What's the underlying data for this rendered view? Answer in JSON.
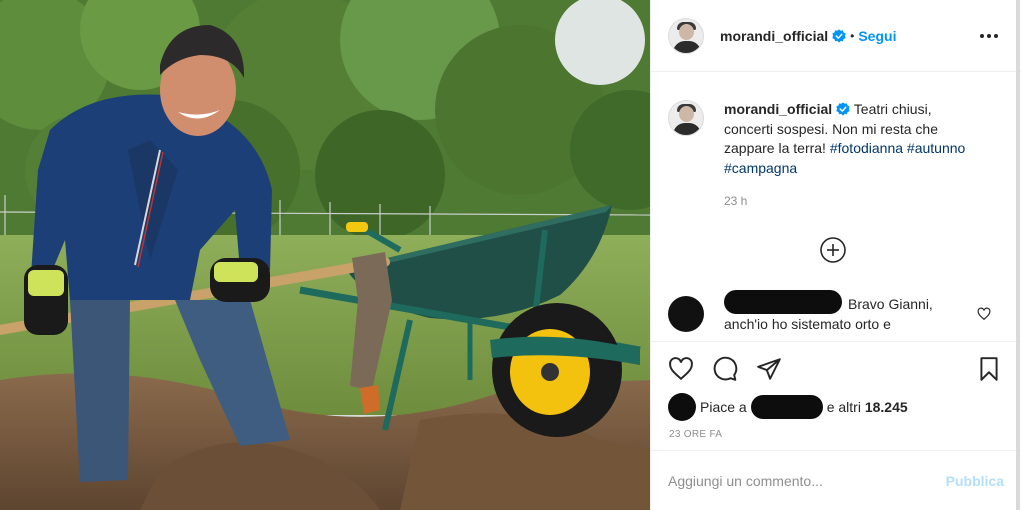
{
  "post": {
    "photo_alt": "",
    "author": {
      "username": "morandi_official",
      "verified": true
    },
    "header": {
      "dot": "•",
      "follow_label": "Segui",
      "more_icon": "more-options-icon"
    },
    "caption": {
      "text_part1": "Teatri chiusi, concerti sospesi. Non mi resta che zappare la terra!",
      "hashtags": [
        "#fotodianna",
        "#autunno",
        "#campagna"
      ],
      "time": "23 h"
    },
    "load_more_icon": "plus-circle-icon",
    "comment": {
      "text": "Bravo Gianni, anch'io ho sistemato orto e",
      "like_icon": "heart-outline-small-icon"
    },
    "actions": {
      "like_icon": "heart-outline-icon",
      "comment_icon": "comment-bubble-icon",
      "share_icon": "paper-plane-icon",
      "save_icon": "bookmark-icon"
    },
    "likes": {
      "prefix": "Piace a",
      "suffix": "e altri",
      "count": "18.245"
    },
    "post_time": "23 ORE FA",
    "add_comment": {
      "placeholder": "Aggiungi un commento...",
      "publish_label": "Pubblica"
    },
    "colors": {
      "accent": "#0095f6",
      "publish_disabled": "#b2dffc",
      "hashtag": "#00376b",
      "muted": "#8e8e8e"
    }
  }
}
